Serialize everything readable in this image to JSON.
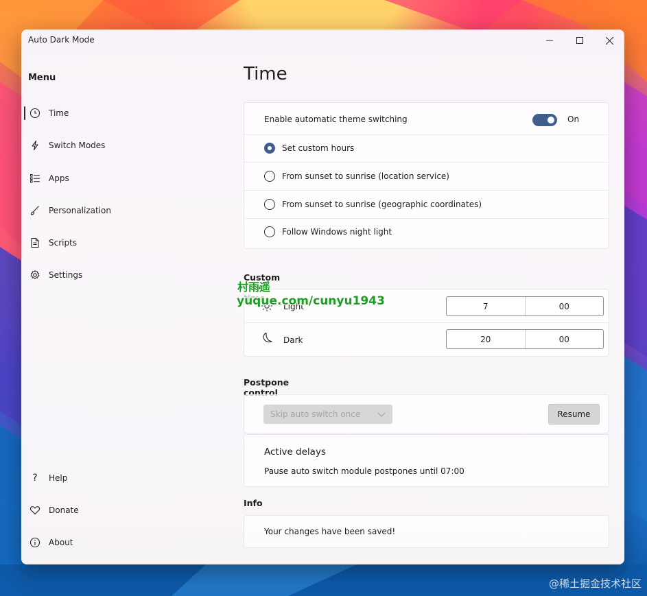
{
  "app": {
    "title": "Auto Dark Mode"
  },
  "window_controls": {
    "minimize": "—",
    "maximize": "☐",
    "close": "✕"
  },
  "sidebar": {
    "menu_label": "Menu",
    "items": [
      {
        "label": "Time",
        "icon": "clock-icon"
      },
      {
        "label": "Switch Modes",
        "icon": "lightning-icon"
      },
      {
        "label": "Apps",
        "icon": "list-icon"
      },
      {
        "label": "Personalization",
        "icon": "brush-icon"
      },
      {
        "label": "Scripts",
        "icon": "document-icon"
      },
      {
        "label": "Settings",
        "icon": "gear-icon"
      }
    ],
    "bottom_items": [
      {
        "label": "Help",
        "icon": "question-icon"
      },
      {
        "label": "Donate",
        "icon": "heart-icon"
      },
      {
        "label": "About",
        "icon": "info-icon"
      }
    ]
  },
  "page": {
    "title": "Time"
  },
  "switching": {
    "enable_label": "Enable automatic theme switching",
    "toggle_state": "On",
    "options": [
      {
        "label": "Set custom hours",
        "selected": true
      },
      {
        "label": "From sunset to sunrise (location service)",
        "selected": false
      },
      {
        "label": "From sunset to sunrise (geographic coordinates)",
        "selected": false
      },
      {
        "label": "Follow Windows night light",
        "selected": false
      }
    ]
  },
  "custom_time": {
    "label": "Custom start time",
    "light": {
      "label": "Light",
      "hour": "7",
      "minute": "00"
    },
    "dark": {
      "label": "Dark",
      "hour": "20",
      "minute": "00"
    }
  },
  "postpone": {
    "label": "Postpone control",
    "dropdown_value": "Skip auto switch once",
    "resume_label": "Resume",
    "active_delays_title": "Active delays",
    "active_delays_text": "Pause auto switch module postpones until 07:00"
  },
  "info": {
    "label": "Info",
    "text": "Your changes have been saved!"
  },
  "watermarks": {
    "line1": "村雨遥",
    "line2": "yuque.com/cunyu1943",
    "corner": "@稀土掘金技术社区"
  },
  "colors": {
    "accent": "#3f5e8c",
    "watermark": "#1f9d23"
  }
}
